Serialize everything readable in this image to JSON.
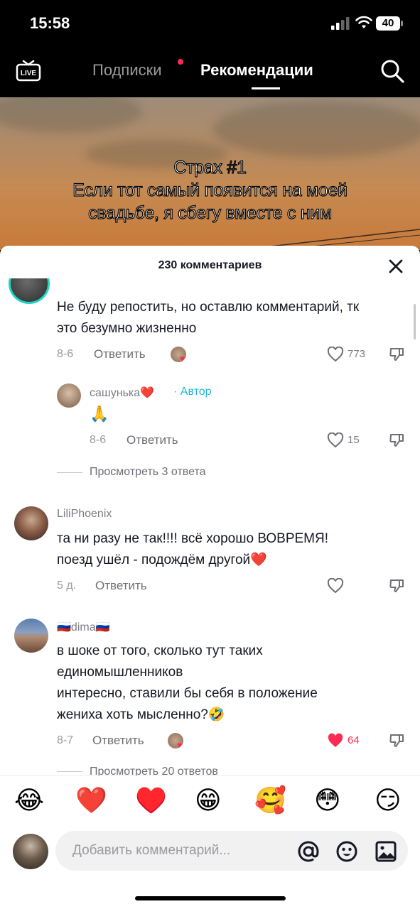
{
  "status_bar": {
    "time": "15:58",
    "battery": "40"
  },
  "header": {
    "live_label": "LIVE",
    "tab_following": "Подписки",
    "tab_for_you": "Рекомендации"
  },
  "video": {
    "overlay_lines": [
      "Страх #1",
      "Если тот самый появится на моей",
      "свадьбе, я сбегу вместе с ним"
    ]
  },
  "comments_sheet": {
    "title": "230 комментариев",
    "comments": [
      {
        "text_lines": [
          "Не буду репостить, но оставлю комментарий, тк",
          "это безумно жизненно"
        ],
        "date": "8-6",
        "reply_label": "Ответить",
        "likes": "773"
      },
      {
        "username": "сашунька❤️",
        "author_tag": "· Автор",
        "text": "🙏",
        "date": "8-6",
        "reply_label": "Ответить",
        "likes": "15"
      },
      {
        "view_replies": "Просмотреть 3 ответа"
      },
      {
        "username": "LiliPhoenix",
        "text_lines": [
          "та ни разу не так!!!! всё хорошо ВОВРЕМЯ!",
          "поезд ушёл - подождём другой❤️"
        ],
        "date": "5 д.",
        "reply_label": "Ответить",
        "likes": ""
      },
      {
        "username": "🇷🇺dima🇷🇺",
        "text_lines": [
          "в шоке от того, сколько тут таких",
          "единомышленников",
          "интересно, ставили бы себя в положение",
          "жениха хоть мысленно?🤣"
        ],
        "date": "8-7",
        "reply_label": "Ответить",
        "likes": "64"
      },
      {
        "view_replies": "Просмотреть 20 ответов"
      }
    ]
  },
  "emoji_bar": [
    "😂",
    "❤️",
    "♥️",
    "😁",
    "🥰",
    "😳",
    "😏"
  ],
  "composer": {
    "placeholder": "Добавить комментарий...",
    "icons": [
      "at-icon",
      "emoji-icon",
      "image-icon"
    ]
  },
  "colors": {
    "accent_red": "#fe2c55",
    "sheet_bg": "#ffffff",
    "text": "#161823"
  }
}
